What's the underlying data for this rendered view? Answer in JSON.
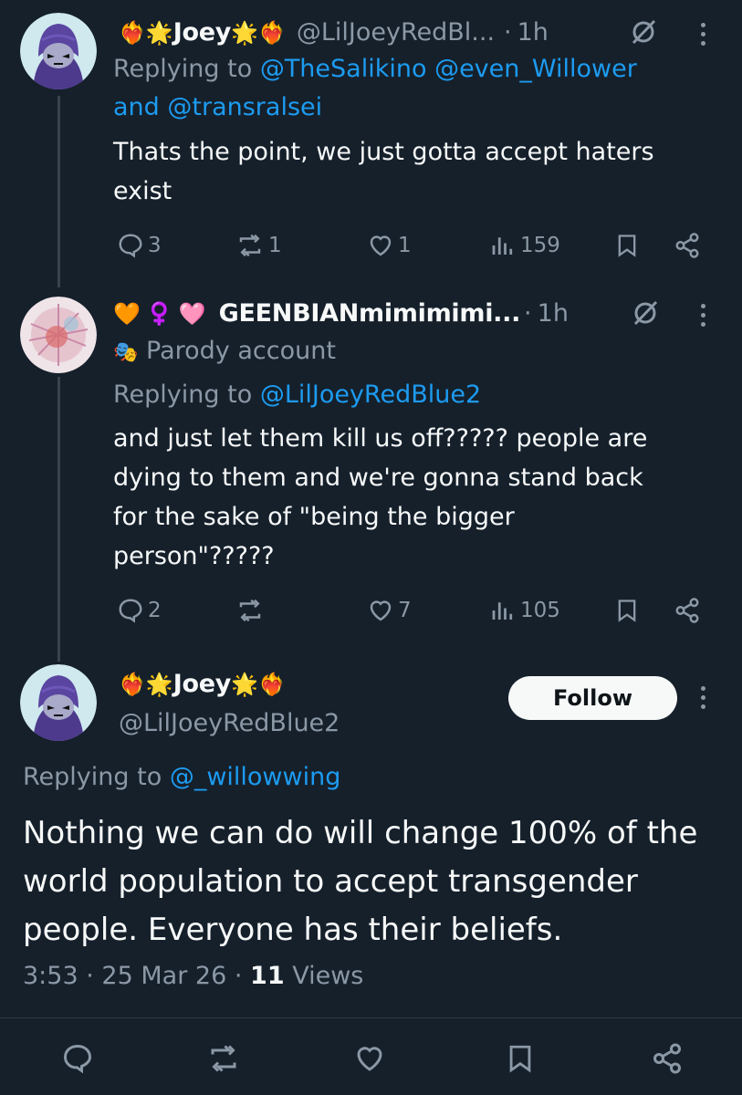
{
  "tweet1": {
    "name_emoji_left": "❤️‍🔥🌟",
    "name": "Joey",
    "name_emoji_right": "🌟❤️‍🔥",
    "handle": "@LilJoeyRedBl...",
    "time": "1h",
    "replying_prefix": "Replying to",
    "replying_to_line1": "@TheSalikino @even_Willower",
    "replying_and": "and",
    "replying_to_line2": "@transralsei",
    "text_line1": "Thats the point, we just gotta accept haters",
    "text_line2": "exist",
    "replies": "3",
    "retweets": "1",
    "likes": "1",
    "views": "159"
  },
  "tweet2": {
    "name_emoji": "🧡♀️🩷",
    "name": "GEENBIANmimimimi...",
    "time": "1h",
    "badge_icon": "🎭",
    "parody_label": "Parody account",
    "replying_prefix": "Replying to",
    "replying_to": "@LilJoeyRedBlue2",
    "text_line1": "and just let them kill us off????? people are",
    "text_line2": "dying to them and we're gonna stand back",
    "text_line3": "for the sake of \"being the bigger",
    "text_line4": "person\"?????",
    "replies": "2",
    "retweets": "",
    "likes": "7",
    "views": "105"
  },
  "main_tweet": {
    "name_emoji_left": "❤️‍🔥🌟",
    "name": "Joey",
    "name_emoji_right": "🌟❤️‍🔥",
    "handle": "@LilJoeyRedBlue2",
    "follow_label": "Follow",
    "replying_prefix": "Replying to",
    "replying_to": "@_willowwing",
    "text_line1": "Nothing we can do will change 100% of the",
    "text_line2": "world population to accept transgender",
    "text_line3": "people. Everyone has their beliefs.",
    "time": "3:53",
    "date": "25 Mar 26",
    "views_count": "11",
    "views_label": "Views"
  },
  "colors": {
    "background": "#15202b",
    "text": "#f7f9f9",
    "secondary": "#8b98a5",
    "link": "#1d9bf0"
  }
}
